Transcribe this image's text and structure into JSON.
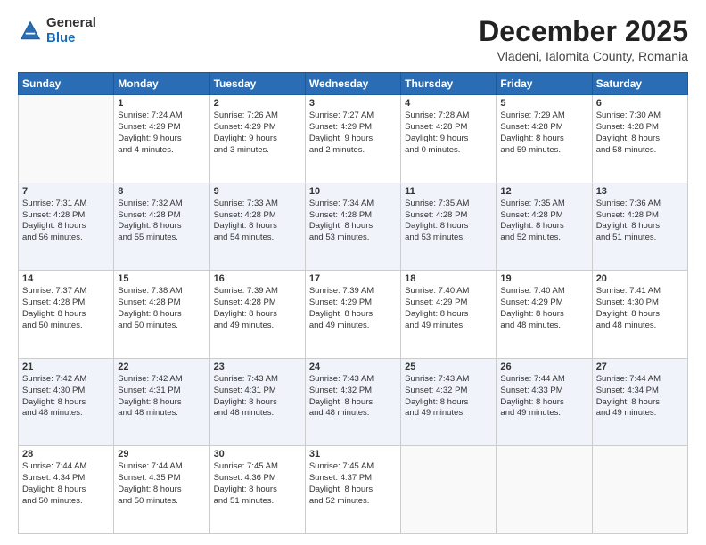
{
  "header": {
    "logo_general": "General",
    "logo_blue": "Blue",
    "month_title": "December 2025",
    "location": "Vladeni, Ialomita County, Romania"
  },
  "days_of_week": [
    "Sunday",
    "Monday",
    "Tuesday",
    "Wednesday",
    "Thursday",
    "Friday",
    "Saturday"
  ],
  "weeks": [
    [
      {
        "day": "",
        "sunrise": "",
        "sunset": "",
        "daylight": ""
      },
      {
        "day": "1",
        "sunrise": "Sunrise: 7:24 AM",
        "sunset": "Sunset: 4:29 PM",
        "daylight": "Daylight: 9 hours and 4 minutes."
      },
      {
        "day": "2",
        "sunrise": "Sunrise: 7:26 AM",
        "sunset": "Sunset: 4:29 PM",
        "daylight": "Daylight: 9 hours and 3 minutes."
      },
      {
        "day": "3",
        "sunrise": "Sunrise: 7:27 AM",
        "sunset": "Sunset: 4:29 PM",
        "daylight": "Daylight: 9 hours and 2 minutes."
      },
      {
        "day": "4",
        "sunrise": "Sunrise: 7:28 AM",
        "sunset": "Sunset: 4:28 PM",
        "daylight": "Daylight: 9 hours and 0 minutes."
      },
      {
        "day": "5",
        "sunrise": "Sunrise: 7:29 AM",
        "sunset": "Sunset: 4:28 PM",
        "daylight": "Daylight: 8 hours and 59 minutes."
      },
      {
        "day": "6",
        "sunrise": "Sunrise: 7:30 AM",
        "sunset": "Sunset: 4:28 PM",
        "daylight": "Daylight: 8 hours and 58 minutes."
      }
    ],
    [
      {
        "day": "7",
        "sunrise": "Sunrise: 7:31 AM",
        "sunset": "Sunset: 4:28 PM",
        "daylight": "Daylight: 8 hours and 56 minutes."
      },
      {
        "day": "8",
        "sunrise": "Sunrise: 7:32 AM",
        "sunset": "Sunset: 4:28 PM",
        "daylight": "Daylight: 8 hours and 55 minutes."
      },
      {
        "day": "9",
        "sunrise": "Sunrise: 7:33 AM",
        "sunset": "Sunset: 4:28 PM",
        "daylight": "Daylight: 8 hours and 54 minutes."
      },
      {
        "day": "10",
        "sunrise": "Sunrise: 7:34 AM",
        "sunset": "Sunset: 4:28 PM",
        "daylight": "Daylight: 8 hours and 53 minutes."
      },
      {
        "day": "11",
        "sunrise": "Sunrise: 7:35 AM",
        "sunset": "Sunset: 4:28 PM",
        "daylight": "Daylight: 8 hours and 53 minutes."
      },
      {
        "day": "12",
        "sunrise": "Sunrise: 7:35 AM",
        "sunset": "Sunset: 4:28 PM",
        "daylight": "Daylight: 8 hours and 52 minutes."
      },
      {
        "day": "13",
        "sunrise": "Sunrise: 7:36 AM",
        "sunset": "Sunset: 4:28 PM",
        "daylight": "Daylight: 8 hours and 51 minutes."
      }
    ],
    [
      {
        "day": "14",
        "sunrise": "Sunrise: 7:37 AM",
        "sunset": "Sunset: 4:28 PM",
        "daylight": "Daylight: 8 hours and 50 minutes."
      },
      {
        "day": "15",
        "sunrise": "Sunrise: 7:38 AM",
        "sunset": "Sunset: 4:28 PM",
        "daylight": "Daylight: 8 hours and 50 minutes."
      },
      {
        "day": "16",
        "sunrise": "Sunrise: 7:39 AM",
        "sunset": "Sunset: 4:28 PM",
        "daylight": "Daylight: 8 hours and 49 minutes."
      },
      {
        "day": "17",
        "sunrise": "Sunrise: 7:39 AM",
        "sunset": "Sunset: 4:29 PM",
        "daylight": "Daylight: 8 hours and 49 minutes."
      },
      {
        "day": "18",
        "sunrise": "Sunrise: 7:40 AM",
        "sunset": "Sunset: 4:29 PM",
        "daylight": "Daylight: 8 hours and 49 minutes."
      },
      {
        "day": "19",
        "sunrise": "Sunrise: 7:40 AM",
        "sunset": "Sunset: 4:29 PM",
        "daylight": "Daylight: 8 hours and 48 minutes."
      },
      {
        "day": "20",
        "sunrise": "Sunrise: 7:41 AM",
        "sunset": "Sunset: 4:30 PM",
        "daylight": "Daylight: 8 hours and 48 minutes."
      }
    ],
    [
      {
        "day": "21",
        "sunrise": "Sunrise: 7:42 AM",
        "sunset": "Sunset: 4:30 PM",
        "daylight": "Daylight: 8 hours and 48 minutes."
      },
      {
        "day": "22",
        "sunrise": "Sunrise: 7:42 AM",
        "sunset": "Sunset: 4:31 PM",
        "daylight": "Daylight: 8 hours and 48 minutes."
      },
      {
        "day": "23",
        "sunrise": "Sunrise: 7:43 AM",
        "sunset": "Sunset: 4:31 PM",
        "daylight": "Daylight: 8 hours and 48 minutes."
      },
      {
        "day": "24",
        "sunrise": "Sunrise: 7:43 AM",
        "sunset": "Sunset: 4:32 PM",
        "daylight": "Daylight: 8 hours and 48 minutes."
      },
      {
        "day": "25",
        "sunrise": "Sunrise: 7:43 AM",
        "sunset": "Sunset: 4:32 PM",
        "daylight": "Daylight: 8 hours and 49 minutes."
      },
      {
        "day": "26",
        "sunrise": "Sunrise: 7:44 AM",
        "sunset": "Sunset: 4:33 PM",
        "daylight": "Daylight: 8 hours and 49 minutes."
      },
      {
        "day": "27",
        "sunrise": "Sunrise: 7:44 AM",
        "sunset": "Sunset: 4:34 PM",
        "daylight": "Daylight: 8 hours and 49 minutes."
      }
    ],
    [
      {
        "day": "28",
        "sunrise": "Sunrise: 7:44 AM",
        "sunset": "Sunset: 4:34 PM",
        "daylight": "Daylight: 8 hours and 50 minutes."
      },
      {
        "day": "29",
        "sunrise": "Sunrise: 7:44 AM",
        "sunset": "Sunset: 4:35 PM",
        "daylight": "Daylight: 8 hours and 50 minutes."
      },
      {
        "day": "30",
        "sunrise": "Sunrise: 7:45 AM",
        "sunset": "Sunset: 4:36 PM",
        "daylight": "Daylight: 8 hours and 51 minutes."
      },
      {
        "day": "31",
        "sunrise": "Sunrise: 7:45 AM",
        "sunset": "Sunset: 4:37 PM",
        "daylight": "Daylight: 8 hours and 52 minutes."
      },
      {
        "day": "",
        "sunrise": "",
        "sunset": "",
        "daylight": ""
      },
      {
        "day": "",
        "sunrise": "",
        "sunset": "",
        "daylight": ""
      },
      {
        "day": "",
        "sunrise": "",
        "sunset": "",
        "daylight": ""
      }
    ]
  ]
}
